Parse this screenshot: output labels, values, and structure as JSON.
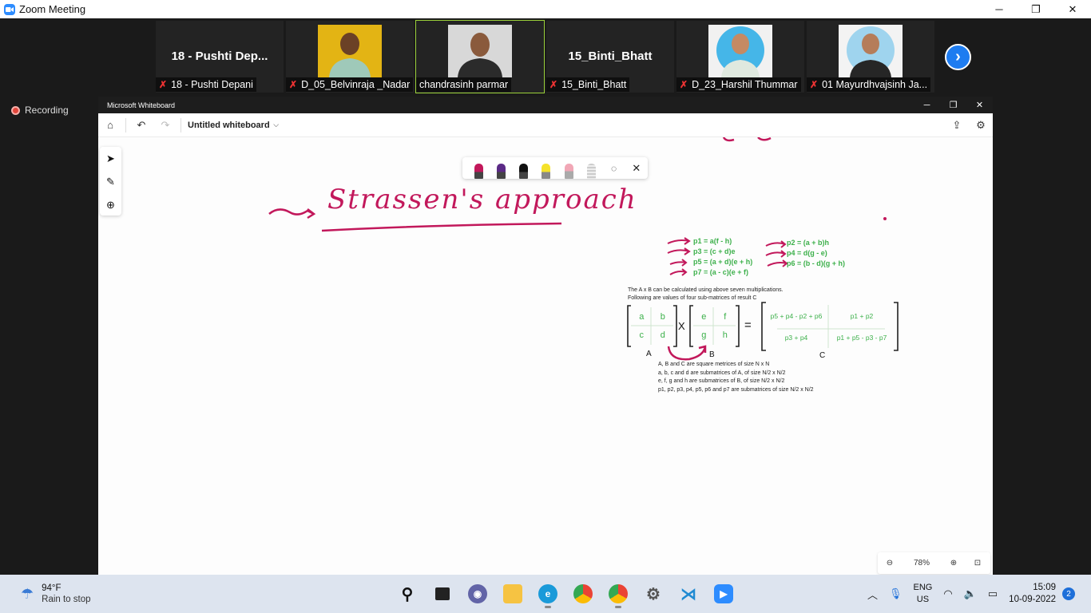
{
  "zoom": {
    "title": "Zoom Meeting",
    "recording": "Recording",
    "participants": [
      {
        "big_name": "18 - Pushti Dep...",
        "label": "18 - Pushti Depani",
        "muted": true,
        "video": false
      },
      {
        "big_name": "",
        "label": "D_05_Belvinraja _Nadar",
        "muted": true,
        "video": true
      },
      {
        "big_name": "",
        "label": "chandrasinh parmar",
        "muted": false,
        "video": true
      },
      {
        "big_name": "15_Binti_Bhatt",
        "label": "15_Binti_Bhatt",
        "muted": true,
        "video": false
      },
      {
        "big_name": "",
        "label": "D_23_Harshil Thummar",
        "muted": true,
        "video": true
      },
      {
        "big_name": "",
        "label": "01 Mayurdhvajsinh Ja...",
        "muted": true,
        "video": true
      }
    ]
  },
  "whiteboard": {
    "window_title": "Microsoft Whiteboard",
    "board_name": "Untitled whiteboard",
    "zoom_level": "78%",
    "handwriting": "Strassen's approach",
    "formulas_left": [
      "p1 = a(f - h)",
      "p3 = (c + d)e",
      "p5 = (a + d)(e + h)",
      "p7 = (a - c)(e + f)"
    ],
    "formulas_right": [
      "p2 = (a + b)h",
      "p4 = d(g - e)",
      "p6 = (b - d)(g + h)"
    ],
    "desc_line1": "The A x B can be calculated using above seven multiplications.",
    "desc_line2": "Following are values of four sub-matrices of result C",
    "matrix_a": [
      "a",
      "b",
      "c",
      "d"
    ],
    "matrix_b": [
      "e",
      "f",
      "g",
      "h"
    ],
    "matrix_c": [
      "p5 + p4 - p2 + p6",
      "p1 + p2",
      "p3 + p4",
      "p1 + p5 - p3 - p7"
    ],
    "label_a": "A",
    "label_b": "B",
    "label_c": "C",
    "times": "X",
    "equals": "=",
    "notes": [
      "A, B and C are square metrices of size N x N",
      "a, b, c and d are submatrices of A, of size N/2 x N/2",
      "e, f, g and h are submatrices of B, of size N/2 x N/2",
      "p1, p2, p3, p4, p5, p6 and p7 are submatrices of size N/2 x N/2"
    ],
    "accent_color": "#c2185b",
    "formula_color": "#3cb04a"
  },
  "taskbar": {
    "temp": "94°F",
    "weather": "Rain to stop",
    "lang1": "ENG",
    "lang2": "US",
    "time": "15:09",
    "date": "10-09-2022",
    "notifications": "2"
  }
}
